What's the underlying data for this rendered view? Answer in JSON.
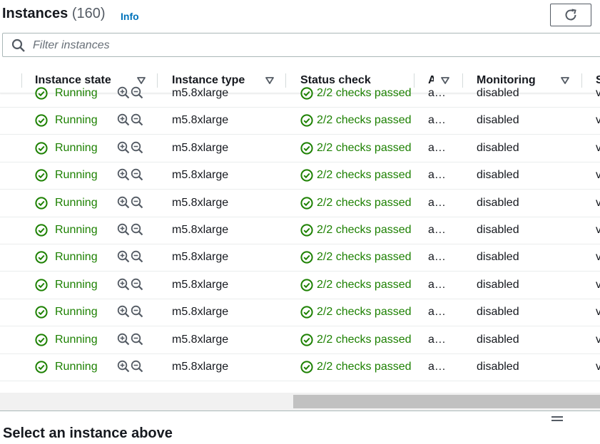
{
  "header": {
    "title": "Instances",
    "count": "(160)",
    "info": "Info"
  },
  "search": {
    "placeholder": "Filter instances"
  },
  "table": {
    "columns": [
      {
        "key": "instance_state",
        "label": "Instance state"
      },
      {
        "key": "instance_type",
        "label": "Instance type"
      },
      {
        "key": "status_check",
        "label": "Status check"
      },
      {
        "key": "alarm",
        "label": "A"
      },
      {
        "key": "monitoring",
        "label": "Monitoring"
      },
      {
        "key": "next",
        "label": "S"
      }
    ],
    "rows": [
      {
        "state": "Running",
        "type": "m5.8xlarge",
        "status": "2/2 checks passed",
        "alarm": "a…",
        "monitoring": "disabled",
        "next": "v"
      },
      {
        "state": "Running",
        "type": "m5.8xlarge",
        "status": "2/2 checks passed",
        "alarm": "a…",
        "monitoring": "disabled",
        "next": "v"
      },
      {
        "state": "Running",
        "type": "m5.8xlarge",
        "status": "2/2 checks passed",
        "alarm": "a…",
        "monitoring": "disabled",
        "next": "v"
      },
      {
        "state": "Running",
        "type": "m5.8xlarge",
        "status": "2/2 checks passed",
        "alarm": "a…",
        "monitoring": "disabled",
        "next": "v"
      },
      {
        "state": "Running",
        "type": "m5.8xlarge",
        "status": "2/2 checks passed",
        "alarm": "a…",
        "monitoring": "disabled",
        "next": "v"
      },
      {
        "state": "Running",
        "type": "m5.8xlarge",
        "status": "2/2 checks passed",
        "alarm": "a…",
        "monitoring": "disabled",
        "next": "v"
      },
      {
        "state": "Running",
        "type": "m5.8xlarge",
        "status": "2/2 checks passed",
        "alarm": "a…",
        "monitoring": "disabled",
        "next": "v"
      },
      {
        "state": "Running",
        "type": "m5.8xlarge",
        "status": "2/2 checks passed",
        "alarm": "a…",
        "monitoring": "disabled",
        "next": "v"
      },
      {
        "state": "Running",
        "type": "m5.8xlarge",
        "status": "2/2 checks passed",
        "alarm": "a…",
        "monitoring": "disabled",
        "next": "v"
      },
      {
        "state": "Running",
        "type": "m5.8xlarge",
        "status": "2/2 checks passed",
        "alarm": "a…",
        "monitoring": "disabled",
        "next": "v"
      },
      {
        "state": "Running",
        "type": "m5.8xlarge",
        "status": "2/2 checks passed",
        "alarm": "a…",
        "monitoring": "disabled",
        "next": "v"
      }
    ]
  },
  "bottom": {
    "title": "Select an instance above"
  },
  "icons": {
    "search": "search-icon",
    "refresh": "refresh-icon",
    "sort": "caret-down-icon",
    "state": "check-circle-icon",
    "zoom_in": "zoom-in-icon",
    "zoom_out": "zoom-out-icon",
    "resize": "drag-handle-icon"
  },
  "colors": {
    "success": "#1d8102",
    "link": "#0073bb",
    "text": "#16191f"
  }
}
